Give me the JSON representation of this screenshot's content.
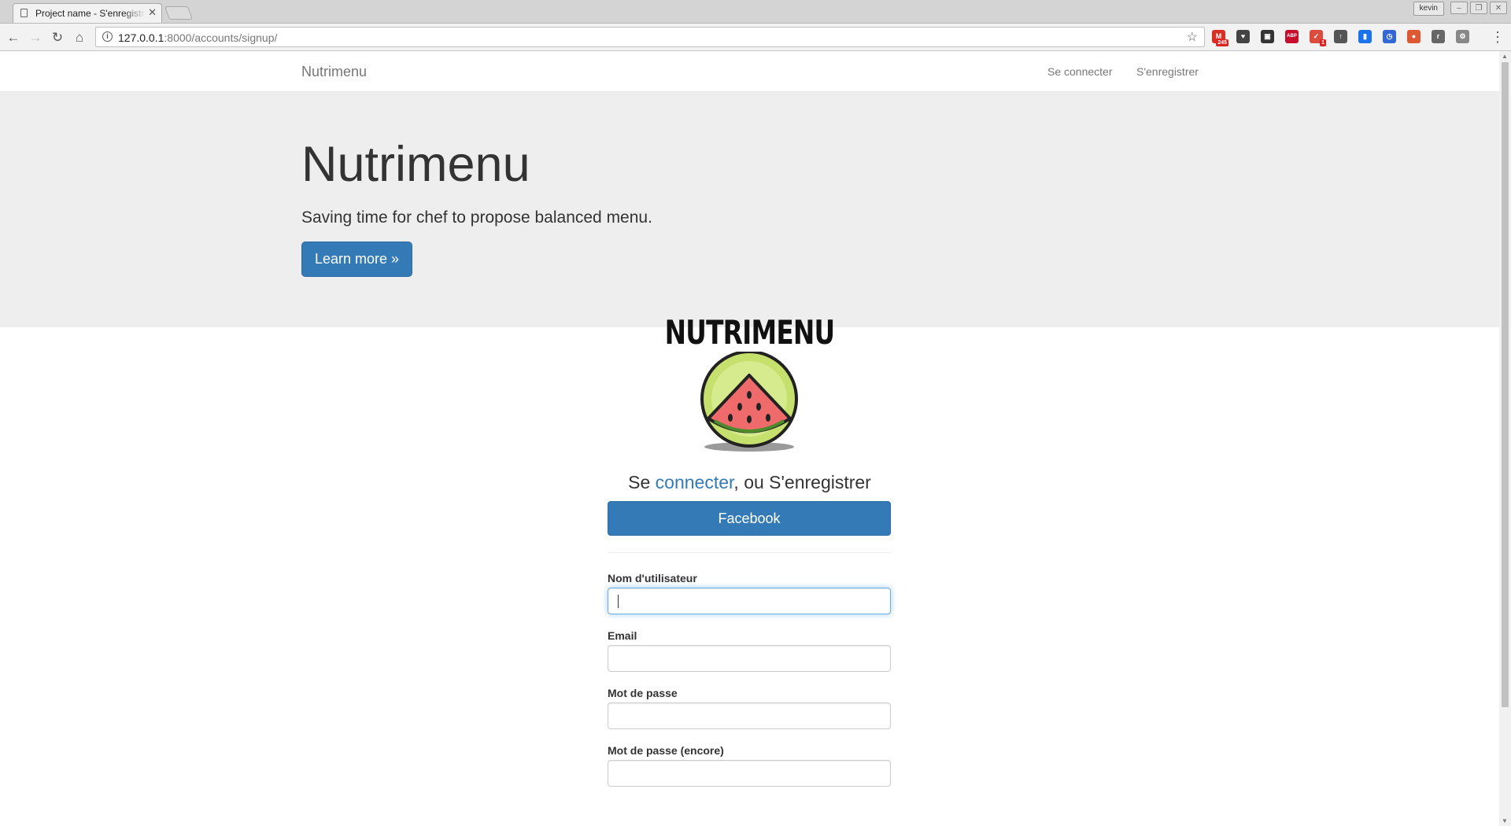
{
  "browser": {
    "tab_title": "Project name - S'enregistrer",
    "tab_close": "✕",
    "profile_name": "kevin",
    "url_host": "127.0.0.1",
    "url_rest": ":8000/accounts/signup/",
    "extensions": [
      {
        "name": "gmail-icon",
        "label": "M",
        "badge": "245",
        "color": "#d93025"
      },
      {
        "name": "pocket-icon",
        "label": "♥",
        "badge": "",
        "color": "#444"
      },
      {
        "name": "extension-icon",
        "label": "▣",
        "badge": "",
        "color": "#333"
      },
      {
        "name": "adblock-icon",
        "label": "ABP",
        "badge": "",
        "color": "#c70d2c"
      },
      {
        "name": "todoist-icon",
        "label": "✓",
        "badge": "1",
        "color": "#db4c3f"
      },
      {
        "name": "upload-icon",
        "label": "↑",
        "badge": "",
        "color": "#555"
      },
      {
        "name": "bookmark-icon",
        "label": "▮",
        "badge": "",
        "color": "#1a73e8"
      },
      {
        "name": "clock-icon",
        "label": "◷",
        "badge": "",
        "color": "#3367d6"
      },
      {
        "name": "duckduckgo-icon",
        "label": "●",
        "badge": "",
        "color": "#de5833"
      },
      {
        "name": "r-icon",
        "label": "r",
        "badge": "",
        "color": "#666"
      },
      {
        "name": "settings-gear-icon",
        "label": "⚙",
        "badge": "",
        "color": "#888"
      }
    ]
  },
  "navbar": {
    "brand": "Nutrimenu",
    "login": "Se connecter",
    "signup": "S'enregistrer"
  },
  "jumbotron": {
    "title": "Nutrimenu",
    "subtitle": "Saving time for chef to propose balanced menu.",
    "button": "Learn more »"
  },
  "logo": {
    "text": "NUTRIMENU"
  },
  "form": {
    "heading_prefix": "Se ",
    "heading_link": "connecter",
    "heading_suffix": ", ou S'enregistrer",
    "facebook_button": "Facebook",
    "fields": [
      {
        "label": "Nom d'utilisateur",
        "value": ""
      },
      {
        "label": "Email",
        "value": ""
      },
      {
        "label": "Mot de passe",
        "value": ""
      },
      {
        "label": "Mot de passe (encore)",
        "value": ""
      }
    ]
  },
  "colors": {
    "primary": "#337ab7",
    "jumbotron_bg": "#eeeeee",
    "melon_rind": "#c6e06d",
    "melon_flesh": "#ef6b6b"
  }
}
